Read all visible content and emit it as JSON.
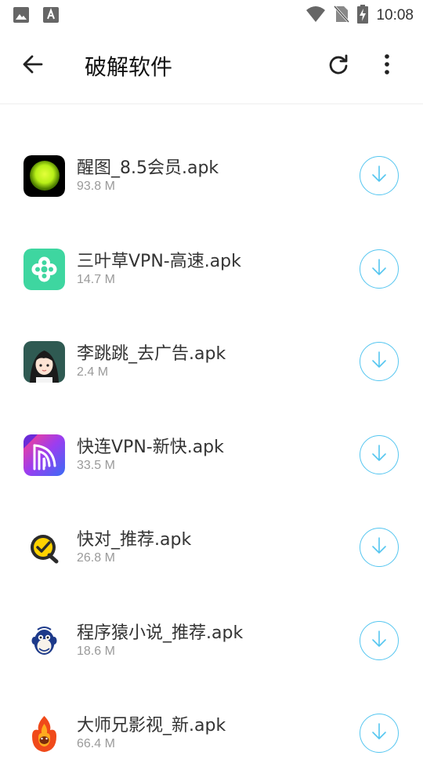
{
  "status_bar": {
    "time": "10:08",
    "icons": [
      "image-notification-icon",
      "font-notification-icon",
      "wifi-icon",
      "no-sim-icon",
      "battery-charging-icon"
    ]
  },
  "app_bar": {
    "title": "破解软件",
    "back_icon": "arrow-back-icon",
    "refresh_icon": "refresh-icon",
    "more_icon": "more-vert-icon"
  },
  "accent_color": "#55c6f0",
  "files": [
    {
      "name": "醒图_8.5会员.apk",
      "size": "93.8 M",
      "icon": "xingtu-app-icon"
    },
    {
      "name": "三叶草VPN-高速.apk",
      "size": "14.7 M",
      "icon": "clover-vpn-app-icon"
    },
    {
      "name": "李跳跳_去广告.apk",
      "size": "2.4 M",
      "icon": "litiaotiao-app-icon"
    },
    {
      "name": "快连VPN-新快.apk",
      "size": "33.5 M",
      "icon": "letsvpn-app-icon"
    },
    {
      "name": "快对_推荐.apk",
      "size": "26.8 M",
      "icon": "kuaidui-app-icon"
    },
    {
      "name": "程序猿小说_推荐.apk",
      "size": "18.6 M",
      "icon": "chengxuyuan-app-icon"
    },
    {
      "name": "大师兄影视_新.apk",
      "size": "66.4 M",
      "icon": "dashixiong-app-icon"
    }
  ]
}
